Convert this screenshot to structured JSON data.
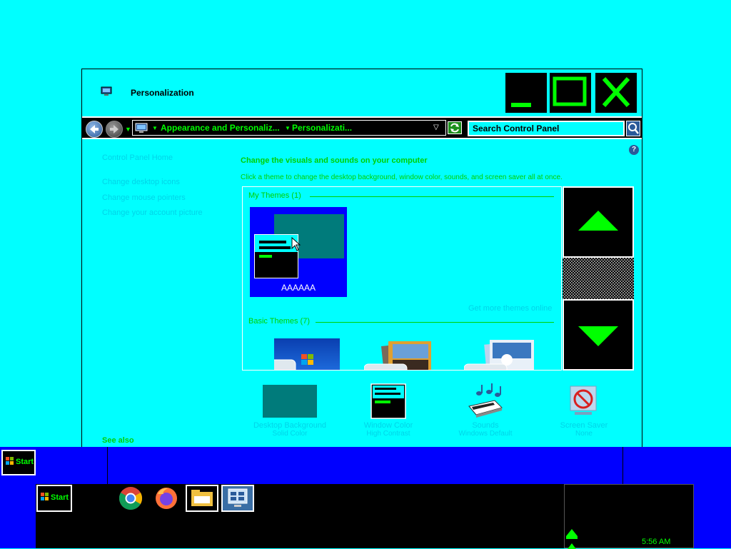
{
  "window": {
    "title": "Personalization",
    "minimize_symbol": "_",
    "close_symbol": "X"
  },
  "address_bar": {
    "breadcrumbs": [
      "Appearance and Personaliz...",
      "Personalizati..."
    ],
    "search_placeholder": "Search Control Panel"
  },
  "left_nav": {
    "home": "Control Panel Home",
    "links": [
      "Change desktop icons",
      "Change mouse pointers",
      "Change your account picture"
    ],
    "see_also": "See also"
  },
  "main": {
    "heading": "Change the visuals and sounds on your computer",
    "subtext": "Click a theme to change the desktop background, window color, sounds, and screen saver all at once.",
    "my_themes_label": "My Themes (1)",
    "selected_theme_name": "AAAAAA",
    "get_more_link": "Get more themes online",
    "basic_themes_label": "Basic Themes (7)"
  },
  "bottom_items": [
    {
      "label": "Desktop Background",
      "sub": "Solid Color"
    },
    {
      "label": "Window Color",
      "sub": "High Contrast"
    },
    {
      "label": "Sounds",
      "sub": "Windows Default"
    },
    {
      "label": "Screen Saver",
      "sub": "None"
    }
  ],
  "taskbar": {
    "start_label": "Start",
    "clock": "5:56 AM",
    "pinned_icons": [
      "chrome-icon",
      "firefox-icon",
      "file-explorer-icon",
      "control-panel-icon"
    ]
  },
  "colors": {
    "desktop": "#00ffff",
    "taskbar": "#0000ff",
    "accent_green": "#00ff00",
    "link_cyan": "#00d4e8"
  }
}
